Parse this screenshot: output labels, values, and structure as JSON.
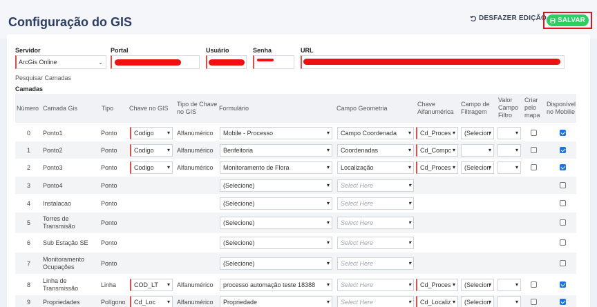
{
  "header": {
    "title": "Configuração do GIS",
    "undo_label": "DESFAZER EDIÇÃO",
    "save_label": "SALVAR",
    "undo_icon": "undo-icon",
    "save_icon": "floppy-disk-icon"
  },
  "connection": {
    "servidor_label": "Servidor",
    "servidor_value": "ArcGis Online",
    "portal_label": "Portal",
    "usuario_label": "Usuário",
    "senha_label": "Senha",
    "url_label": "URL"
  },
  "search_label": "Pesquisar Camadas",
  "camadas_label": "Camadas",
  "table": {
    "headers": {
      "numero": "Número",
      "camada": "Camada Gis",
      "tipo": "Tipo",
      "chave": "Chave no GIS",
      "tipo_chave_1": "Tipo de Chave",
      "tipo_chave_2": "no GIS",
      "formulario": "Formulário",
      "campo_geo": "Campo Geometria",
      "chave_alfa_1": "Chave",
      "chave_alfa_2": "Alfanumérica",
      "campo_filtro_1": "Campo de",
      "campo_filtro_2": "Filtragem",
      "valor_1": "Valor",
      "valor_2": "Campo",
      "valor_3": "Filtro",
      "criar_1": "Criar",
      "criar_2": "pelo",
      "criar_3": "mapa",
      "disp_1": "Disponível",
      "disp_2": "no Mobilie"
    },
    "rows": [
      {
        "num": "0",
        "camada_1": "Ponto1",
        "camada_2": "",
        "tipo": "Ponto",
        "chave": "Codigo",
        "tipo_chave": "Alfanumérico",
        "form": "Mobile - Processo",
        "geo": "Campo Coordenada",
        "alfa": "Cd_Proces",
        "filtro": "(Selecion",
        "disponivel": true
      },
      {
        "num": "1",
        "camada_1": "Ponto2",
        "camada_2": "",
        "tipo": "Ponto",
        "chave": "Codigo",
        "tipo_chave": "Alfanumérico",
        "form": "Benfeitoria",
        "geo": "Coordenadas",
        "alfa": "Cd_Compc",
        "filtro": "",
        "disponivel": true
      },
      {
        "num": "2",
        "camada_1": "Ponto3",
        "camada_2": "",
        "tipo": "Ponto",
        "chave": "Codigo",
        "tipo_chave": "Alfanumérico",
        "form": "Monitoramento de Flora",
        "geo": "Localização",
        "alfa": "Cd_Proces",
        "filtro": "(Selecion",
        "disponivel": true
      },
      {
        "num": "3",
        "camada_1": "Ponto4",
        "camada_2": "",
        "tipo": "Ponto",
        "form": "(Selecione)",
        "geo_ph": "Select Here",
        "disponivel": false
      },
      {
        "num": "4",
        "camada_1": "Instalacao",
        "camada_2": "",
        "tipo": "Ponto",
        "form": "(Selecione)",
        "geo_ph": "Select Here",
        "disponivel": false
      },
      {
        "num": "5",
        "camada_1": "Torres de",
        "camada_2": "Transmisão",
        "tipo": "Ponto",
        "form": "(Selecione)",
        "geo_ph": "Select Here",
        "disponivel": false
      },
      {
        "num": "6",
        "camada_1": "Sub Estação SE",
        "camada_2": "",
        "tipo": "Ponto",
        "form": "(Selecione)",
        "geo_ph": "Select Here",
        "disponivel": false
      },
      {
        "num": "7",
        "camada_1": "Monitoramento",
        "camada_2": "Ocupações",
        "tipo": "Ponto",
        "form": "(Selecione)",
        "geo_ph": "Select Here",
        "disponivel": false
      },
      {
        "num": "8",
        "camada_1": "Linha de",
        "camada_2": "Transmissão",
        "tipo": "Linha",
        "chave": "COD_LT",
        "tipo_chave": "Alfanumérico",
        "form": "processo automação teste 18388",
        "geo_ph": "Select Here",
        "alfa": "Cd_Proces",
        "filtro": "(Selecion",
        "disponivel": true
      },
      {
        "num": "9",
        "camada_1": "Propriedades",
        "camada_2": "",
        "tipo": "Polígono",
        "chave": "Cd_Loc",
        "tipo_chave": "Alfanumérico",
        "form": "Propriedade",
        "geo_ph": "Select Here",
        "alfa": "Cd_Localiz",
        "filtro": "(Selecion",
        "disponivel": true
      }
    ]
  },
  "colors": {
    "title": "#2c3e66",
    "save_bg": "#2dce61",
    "highlight": "#e0111b",
    "checkbox_on": "#1a73e8"
  }
}
